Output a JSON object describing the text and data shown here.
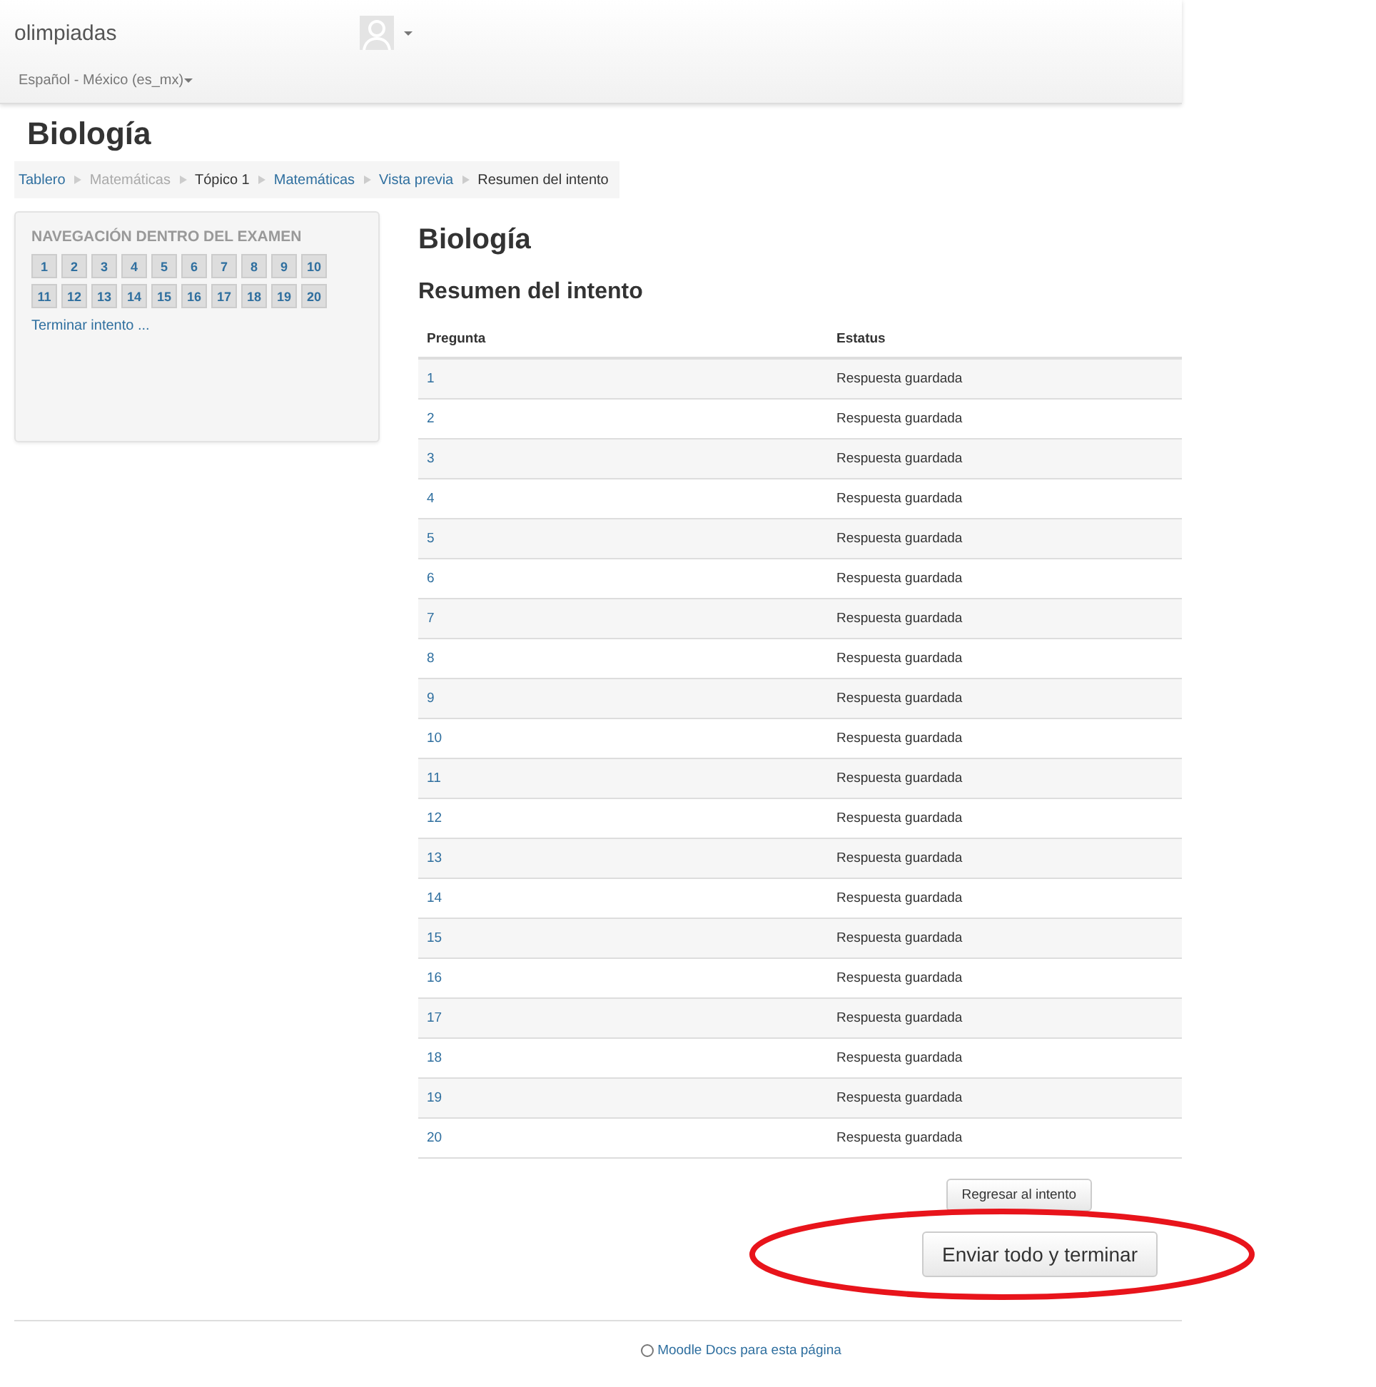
{
  "header": {
    "site_name": "olimpiadas",
    "language": "Español - México (es_mx)"
  },
  "page_title": "Biología",
  "breadcrumb": [
    {
      "label": "Tablero",
      "kind": "link"
    },
    {
      "label": "Matemáticas",
      "kind": "muted"
    },
    {
      "label": "Tópico 1",
      "kind": "plain"
    },
    {
      "label": "Matemáticas",
      "kind": "link"
    },
    {
      "label": "Vista previa",
      "kind": "link"
    },
    {
      "label": "Resumen del intento",
      "kind": "plain"
    }
  ],
  "quiz_nav": {
    "title": "NAVEGACIÓN DENTRO DEL EXAMEN",
    "questions": [
      "1",
      "2",
      "3",
      "4",
      "5",
      "6",
      "7",
      "8",
      "9",
      "10",
      "11",
      "12",
      "13",
      "14",
      "15",
      "16",
      "17",
      "18",
      "19",
      "20"
    ],
    "finish_link": "Terminar intento ..."
  },
  "main": {
    "title": "Biología",
    "subtitle": "Resumen del intento",
    "table": {
      "columns": [
        "Pregunta",
        "Estatus"
      ],
      "rows": [
        [
          "1",
          "Respuesta guardada"
        ],
        [
          "2",
          "Respuesta guardada"
        ],
        [
          "3",
          "Respuesta guardada"
        ],
        [
          "4",
          "Respuesta guardada"
        ],
        [
          "5",
          "Respuesta guardada"
        ],
        [
          "6",
          "Respuesta guardada"
        ],
        [
          "7",
          "Respuesta guardada"
        ],
        [
          "8",
          "Respuesta guardada"
        ],
        [
          "9",
          "Respuesta guardada"
        ],
        [
          "10",
          "Respuesta guardada"
        ],
        [
          "11",
          "Respuesta guardada"
        ],
        [
          "12",
          "Respuesta guardada"
        ],
        [
          "13",
          "Respuesta guardada"
        ],
        [
          "14",
          "Respuesta guardada"
        ],
        [
          "15",
          "Respuesta guardada"
        ],
        [
          "16",
          "Respuesta guardada"
        ],
        [
          "17",
          "Respuesta guardada"
        ],
        [
          "18",
          "Respuesta guardada"
        ],
        [
          "19",
          "Respuesta guardada"
        ],
        [
          "20",
          "Respuesta guardada"
        ]
      ]
    },
    "return_button": "Regresar al intento",
    "submit_button": "Enviar todo y terminar"
  },
  "footer": {
    "docs_link": "Moodle Docs para esta página"
  }
}
